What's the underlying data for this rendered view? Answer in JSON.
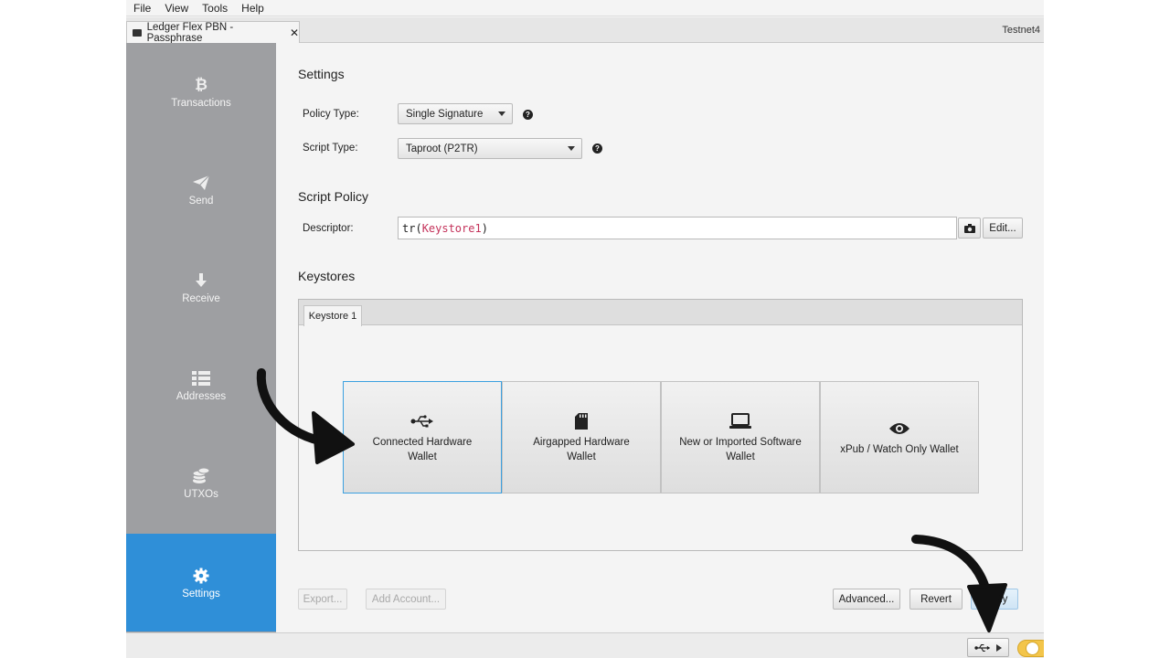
{
  "menu": [
    "File",
    "View",
    "Tools",
    "Help"
  ],
  "window_tab": {
    "title": "Ledger Flex PBN - Passphrase",
    "close": "✕"
  },
  "network": "Testnet4",
  "sidebar": {
    "items": [
      {
        "label": "Transactions",
        "icon": "bitcoin-icon"
      },
      {
        "label": "Send",
        "icon": "send-icon"
      },
      {
        "label": "Receive",
        "icon": "arrow-down-icon"
      },
      {
        "label": "Addresses",
        "icon": "list-icon"
      },
      {
        "label": "UTXOs",
        "icon": "coins-icon"
      },
      {
        "label": "Settings",
        "icon": "gear-icon",
        "active": true
      }
    ]
  },
  "settings": {
    "heading": "Settings",
    "policy_type_label": "Policy Type:",
    "policy_type_value": "Single Signature",
    "script_type_label": "Script Type:",
    "script_type_value": "Taproot (P2TR)",
    "help_glyph": "?"
  },
  "script_policy": {
    "heading": "Script Policy",
    "descriptor_label": "Descriptor:",
    "descriptor_prefix": "tr(",
    "descriptor_keystore": "Keystore1",
    "descriptor_suffix": ")",
    "edit_label": "Edit..."
  },
  "keystores": {
    "heading": "Keystores",
    "tab": "Keystore 1",
    "options": [
      {
        "label": "Connected Hardware Wallet",
        "icon": "usb-icon",
        "selected": true
      },
      {
        "label": "Airgapped Hardware Wallet",
        "icon": "sd-card-icon"
      },
      {
        "label": "New or Imported Software Wallet",
        "icon": "laptop-icon"
      },
      {
        "label": "xPub / Watch Only Wallet",
        "icon": "eye-icon"
      }
    ]
  },
  "buttons": {
    "export": "Export...",
    "add_account": "Add Account...",
    "advanced": "Advanced...",
    "revert": "Revert",
    "apply": "Apply"
  },
  "colors": {
    "sidebar": "#9e9fa2",
    "active": "#2f8fd8",
    "keystore_text": "#c4325a",
    "selected_border": "#3ba0e0"
  }
}
